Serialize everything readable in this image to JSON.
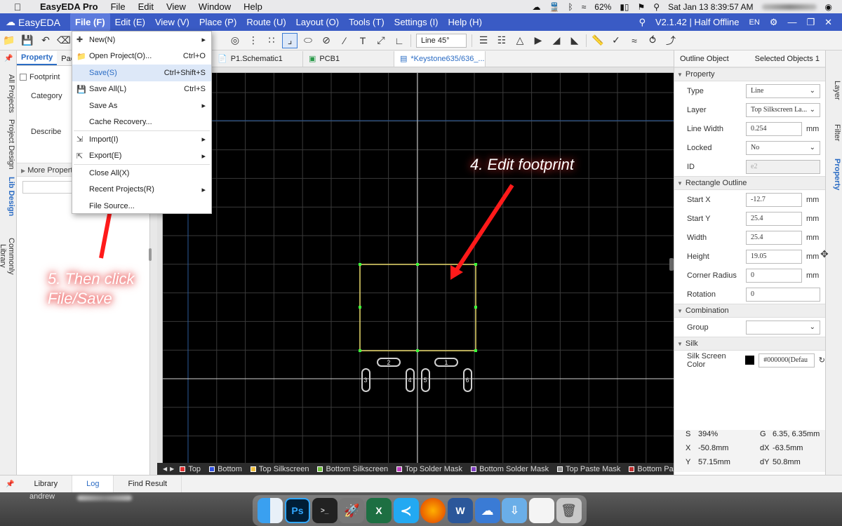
{
  "macbar": {
    "app_name": "EasyEDA Pro",
    "menus": [
      "File",
      "Edit",
      "View",
      "Window",
      "Help"
    ],
    "battery": "62%",
    "datetime": "Sat Jan 13  8:39:57 AM"
  },
  "appbar": {
    "logo_text": "EasyEDA",
    "menus": [
      "File (F)",
      "Edit (E)",
      "View (V)",
      "Place (P)",
      "Route (U)",
      "Layout (O)",
      "Tools (T)",
      "Settings (I)",
      "Help (H)"
    ],
    "version": "V2.1.42 | Half Offline",
    "lang": "EN"
  },
  "toolbar": {
    "line_mode": "Line 45°"
  },
  "left_strip": [
    "All Projects",
    "Project Design",
    "Lib Design",
    "Commonly Library"
  ],
  "left_panel": {
    "tabs": [
      "Property",
      "Pac"
    ],
    "footprint_label": "Footprint",
    "category_label": "Category",
    "describe_label": "Describe",
    "more_label": "More Properties"
  },
  "file_menu": {
    "items": [
      {
        "icon": "new",
        "label": "New(N)",
        "shortcut": "",
        "submenu": true
      },
      {
        "icon": "folder",
        "label": "Open Project(O)...",
        "shortcut": "Ctrl+O",
        "submenu": false
      },
      {
        "icon": "",
        "label": "Save(S)",
        "shortcut": "Ctrl+Shift+S",
        "submenu": false,
        "highlight": true
      },
      {
        "icon": "save",
        "label": "Save All(L)",
        "shortcut": "Ctrl+S",
        "submenu": false
      },
      {
        "icon": "",
        "label": "Save As",
        "shortcut": "",
        "submenu": true
      },
      {
        "icon": "",
        "label": "Cache Recovery...",
        "shortcut": "",
        "submenu": false
      },
      {
        "icon": "import",
        "label": "Import(I)",
        "shortcut": "",
        "submenu": true,
        "sep_before": true
      },
      {
        "icon": "export",
        "label": "Export(E)",
        "shortcut": "",
        "submenu": true
      },
      {
        "icon": "",
        "label": "Close All(X)",
        "shortcut": "",
        "submenu": false,
        "sep_before": true
      },
      {
        "icon": "",
        "label": "Recent Projects(R)",
        "shortcut": "",
        "submenu": true
      },
      {
        "icon": "",
        "label": "File Source...",
        "shortcut": "",
        "submenu": false
      }
    ]
  },
  "doc_tabs": [
    "P1.Schematic1",
    "PCB1",
    "*Keystone635/636_..."
  ],
  "pads": [
    "2",
    "1",
    "3",
    "4",
    "5",
    "6"
  ],
  "layers": [
    {
      "name": "Top",
      "color": "#e03030"
    },
    {
      "name": "Bottom",
      "color": "#3050e0"
    },
    {
      "name": "Top Silkscreen",
      "color": "#f0c040"
    },
    {
      "name": "Bottom Silkscreen",
      "color": "#70c040"
    },
    {
      "name": "Top Solder Mask",
      "color": "#c040c0"
    },
    {
      "name": "Bottom Solder Mask",
      "color": "#8040c0"
    },
    {
      "name": "Top Paste Mask",
      "color": "#909090"
    },
    {
      "name": "Bottom Paste Mask",
      "color": "#c03030"
    }
  ],
  "annotations": {
    "edit": "4. Edit footprint",
    "save_line1": "5. Then click",
    "save_line2": "File/Save"
  },
  "right_panel": {
    "header_left": "Outline Object",
    "header_right": "Selected Objects  1",
    "sections": {
      "property": "Property",
      "rect": "Rectangle Outline",
      "combination": "Combination",
      "silk": "Silk"
    },
    "type": {
      "label": "Type",
      "value": "Line"
    },
    "layer": {
      "label": "Layer",
      "value": "Top Silkscreen La..."
    },
    "line_width": {
      "label": "Line Width",
      "value": "0.254",
      "unit": "mm"
    },
    "locked": {
      "label": "Locked",
      "value": "No"
    },
    "id": {
      "label": "ID",
      "value": "e2"
    },
    "start_x": {
      "label": "Start X",
      "value": "-12.7",
      "unit": "mm"
    },
    "start_y": {
      "label": "Start Y",
      "value": "25.4",
      "unit": "mm"
    },
    "width": {
      "label": "Width",
      "value": "25.4",
      "unit": "mm"
    },
    "height": {
      "label": "Height",
      "value": "19.05",
      "unit": "mm"
    },
    "corner_radius": {
      "label": "Corner Radius",
      "value": "0",
      "unit": "mm"
    },
    "rotation": {
      "label": "Rotation",
      "value": "0"
    },
    "group": {
      "label": "Group",
      "value": ""
    },
    "silk_color": {
      "label": "Silk Screen Color",
      "value": "#000000(Defau"
    },
    "status": {
      "s_label": "S",
      "s_value": "394%",
      "g_label": "G",
      "g_value": "6.35, 6.35mm",
      "x_label": "X",
      "x_value": "-50.8mm",
      "dx_label": "dX",
      "dx_value": "-63.5mm",
      "y_label": "Y",
      "y_value": "57.15mm",
      "dy_label": "dY",
      "dy_value": "50.8mm"
    }
  },
  "right_strip": [
    "Layer",
    "Filter",
    "Property"
  ],
  "bottom_tabs": [
    "Library",
    "Log",
    "Find Result"
  ],
  "dock_user": "andrew",
  "dock_labels": {
    "ps": "Ps",
    "excel": "X",
    "word": "W"
  }
}
